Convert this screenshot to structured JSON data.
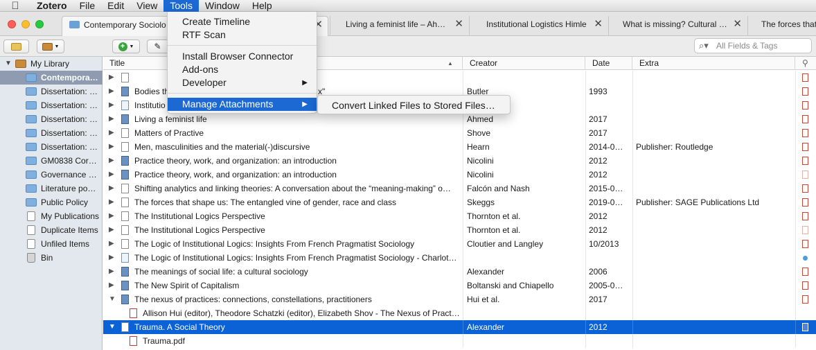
{
  "menubar": {
    "app": "Zotero",
    "items": [
      "File",
      "Edit",
      "View",
      "Tools",
      "Window",
      "Help"
    ],
    "active": "Tools"
  },
  "tabs": [
    {
      "label": "Contemporary Sociolo",
      "active": true
    },
    {
      "label": "Living a feminist life – Ah…"
    },
    {
      "label": "Institutional Logistics Himle"
    },
    {
      "label": "What is missing? Cultural …"
    },
    {
      "label": "The forces that"
    }
  ],
  "toolbar": {
    "search_placeholder": "All Fields & Tags",
    "icons": [
      "new-collection-icon",
      "new-library-icon",
      "new-item-icon",
      "add-by-identifier-icon"
    ]
  },
  "sidebar": {
    "items": [
      {
        "label": "My Library",
        "icon": "library-icon",
        "expanded": true
      },
      {
        "label": "Contempora…",
        "icon": "folder-icon",
        "selected": true
      },
      {
        "label": "Dissertation: …",
        "icon": "folder-icon"
      },
      {
        "label": "Dissertation: …",
        "icon": "folder-icon"
      },
      {
        "label": "Dissertation: …",
        "icon": "folder-icon"
      },
      {
        "label": "Dissertation: …",
        "icon": "folder-icon"
      },
      {
        "label": "Dissertation: …",
        "icon": "folder-icon"
      },
      {
        "label": "GM0838 Cor…",
        "icon": "folder-icon"
      },
      {
        "label": "Governance …",
        "icon": "folder-icon"
      },
      {
        "label": "Literature po…",
        "icon": "folder-icon"
      },
      {
        "label": "Public Policy",
        "icon": "folder-icon"
      },
      {
        "label": "My Publications",
        "icon": "document-icon"
      },
      {
        "label": "Duplicate Items",
        "icon": "duplicate-icon"
      },
      {
        "label": "Unfiled Items",
        "icon": "unfiled-icon"
      },
      {
        "label": "Bin",
        "icon": "trash-icon"
      }
    ]
  },
  "columns": {
    "title": "Title",
    "creator": "Creator",
    "date": "Date",
    "extra": "Extra",
    "sort_indicator": "▲"
  },
  "rows": [
    {
      "title": "",
      "creator": "",
      "date": "",
      "extra": "",
      "type": "doc",
      "att": "pdf"
    },
    {
      "title": "Bodies th",
      "title_tail": "x\"",
      "creator": "Butler",
      "date": "1993",
      "extra": "",
      "type": "book",
      "att": "pdf"
    },
    {
      "title": "Institutio",
      "creator": "",
      "date": "",
      "extra": "",
      "type": "web",
      "att": "pdf"
    },
    {
      "title": "Living a feminist life",
      "creator": "Ahmed",
      "date": "2017",
      "extra": "",
      "type": "book",
      "att": "pdf"
    },
    {
      "title": "Matters of Practive",
      "creator": "Shove",
      "date": "2017",
      "extra": "",
      "type": "doc",
      "att": "pdf"
    },
    {
      "title": "Men, masculinities and the material(-)discursive",
      "creator": "Hearn",
      "date": "2014-0…",
      "extra": "Publisher: Routledge",
      "type": "doc",
      "att": "pdf"
    },
    {
      "title": "Practice theory, work, and organization: an introduction",
      "creator": "Nicolini",
      "date": "2012",
      "extra": "",
      "type": "book",
      "att": "pdf"
    },
    {
      "title": "Practice theory, work, and organization: an introduction",
      "creator": "Nicolini",
      "date": "2012",
      "extra": "",
      "type": "book",
      "att": "pdf-faded"
    },
    {
      "title": "Shifting analytics and linking theories: A conversation about the “meaning-making” o…",
      "creator": "Falcón and Nash",
      "date": "2015-0…",
      "extra": "",
      "type": "doc",
      "att": "pdf"
    },
    {
      "title": "The forces that shape us: The entangled vine of gender, race and class",
      "creator": "Skeggs",
      "date": "2019-0…",
      "extra": "Publisher: SAGE Publications Ltd",
      "type": "doc",
      "att": "pdf"
    },
    {
      "title": "The Institutional Logics Perspective",
      "creator": "Thornton et al.",
      "date": "2012",
      "extra": "",
      "type": "doc",
      "att": "pdf"
    },
    {
      "title": "The Institutional Logics Perspective",
      "creator": "Thornton et al.",
      "date": "2012",
      "extra": "",
      "type": "doc",
      "att": "pdf-faded"
    },
    {
      "title": "The Logic of Institutional Logics: Insights From French Pragmatist Sociology",
      "creator": "Cloutier and Langley",
      "date": "10/2013",
      "extra": "",
      "type": "doc",
      "att": "pdf"
    },
    {
      "title": "The Logic of Institutional Logics: Insights From French Pragmatist Sociology - Charlot…",
      "creator": "",
      "date": "",
      "extra": "",
      "type": "web",
      "att": "dot"
    },
    {
      "title": "The meanings of social life: a cultural sociology",
      "creator": "Alexander",
      "date": "2006",
      "extra": "",
      "type": "book",
      "att": "pdf"
    },
    {
      "title": "The New Spirit of Capitalism",
      "creator": "Boltanski and Chiapello",
      "date": "2005-0…",
      "extra": "",
      "type": "book",
      "att": "pdf"
    },
    {
      "title": "The nexus of practices: connections, constellations, practitioners",
      "creator": "Hui et al.",
      "date": "2017",
      "extra": "",
      "type": "book",
      "att": "pdf",
      "expanded": true
    },
    {
      "title": "Allison Hui (editor), Theodore Schatzki (editor), Elizabeth Shov - The Nexus of Pract…",
      "creator": "",
      "date": "",
      "extra": "",
      "type": "pdf",
      "child": true
    },
    {
      "title": "Trauma. A Social Theory",
      "creator": "Alexander",
      "date": "2012",
      "extra": "",
      "type": "doc",
      "att": "pdf",
      "expanded": true,
      "selected": true
    },
    {
      "title": "Trauma.pdf",
      "creator": "",
      "date": "",
      "extra": "",
      "type": "pdf",
      "child": true
    }
  ],
  "tools_menu": {
    "items": [
      "Create Timeline",
      "RTF Scan",
      "Install Browser Connector",
      "Add-ons",
      "Developer",
      "Manage Attachments"
    ],
    "highlighted": "Manage Attachments",
    "submenu_items": [
      "Convert Linked Files to Stored Files…"
    ]
  },
  "colors": {
    "accent": "#1c69d4",
    "selection": "#0b62d6",
    "sidebar_selected": "#8e9bb0"
  }
}
